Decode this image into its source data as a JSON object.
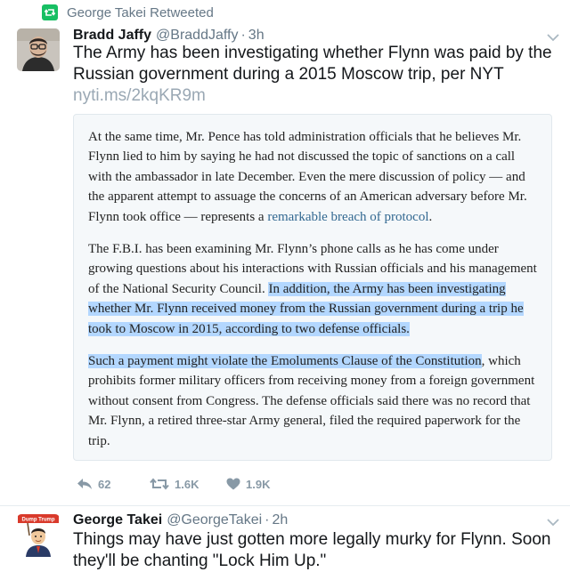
{
  "retweet_banner": {
    "text": "George Takei Retweeted"
  },
  "tweet1": {
    "name": "Bradd Jaffy",
    "handle": "@BraddJaffy",
    "separator": "·",
    "time": "3h",
    "text": "The Army has been investigating whether Flynn was paid by the Russian government during a 2015 Moscow trip, per NYT ",
    "link": "nyti.ms/2kqKR9m",
    "quote": {
      "p1_text": "At the same time, Mr. Pence has told administration officials that he believes Mr. Flynn lied to him by saying he had not discussed the topic of sanctions on a call with the ambassador in late December. Even the mere discussion of policy — and the apparent attempt to assuage the concerns of an American adversary before Mr. Flynn took office — represents a ",
      "p1_link": "remarkable breach of protocol",
      "p1_end": ".",
      "p2_plain": "The F.B.I. has been examining Mr. Flynn’s phone calls as he has come under growing questions about his interactions with Russian officials and his management of the National Security Council. ",
      "p2_highlight": "In addition, the Army has been investigating whether Mr. Flynn received money from the Russian government during a trip he took to Moscow in 2015, according to two defense officials.",
      "p3_highlight": "Such a payment might violate the Emoluments Clause of the Constitution",
      "p3_plain": ", which prohibits former military officers from receiving money from a foreign government without consent from Congress. The defense officials said there was no record that Mr. Flynn, a retired three-star Army general, filed the required paperwork for the trip."
    },
    "actions": {
      "replies": "62",
      "retweets": "1.6K",
      "likes": "1.9K"
    }
  },
  "tweet2": {
    "name": "George Takei",
    "handle": "@GeorgeTakei",
    "separator": "·",
    "time": "2h",
    "text": "Things may have just gotten more legally murky for Flynn. Soon they'll be chanting \"Lock Him Up.\"",
    "avatar_sign": "Dump Trump"
  },
  "colors": {
    "retweet_green": "#17bf63",
    "muted_gray": "#657786",
    "link_gray": "#9aa8b4",
    "article_link": "#326891",
    "highlight": "#b3d7ff"
  }
}
